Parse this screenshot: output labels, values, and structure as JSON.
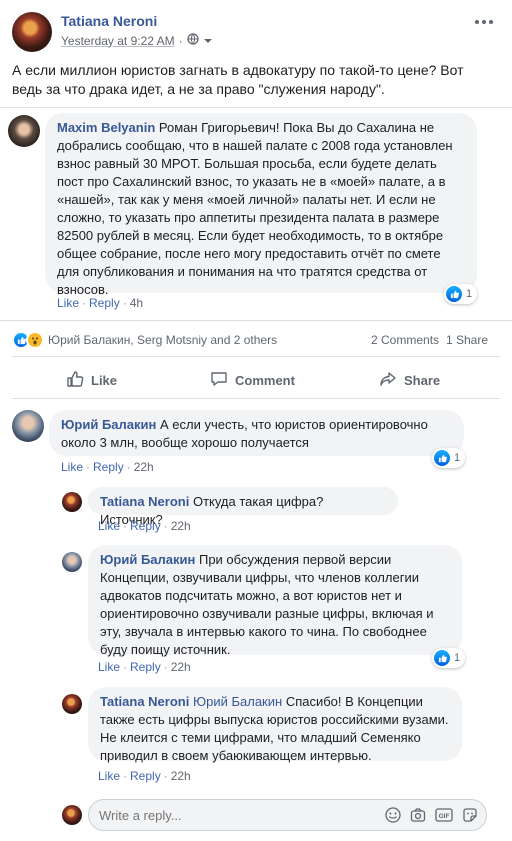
{
  "post": {
    "author": "Tatiana Neroni",
    "timestamp": "Yesterday at 9:22 AM",
    "audience_icon": "globe-icon",
    "text": "А если миллион юристов загнать в адвокатуру по такой-то цене? Вот ведь за что драка идет, а не за право \"служения народу\"."
  },
  "top_comment": {
    "author": "Maxim Belyanin",
    "text": "Роман Григорьевич! Пока Вы до Сахалина не добрались сообщаю, что в нашей палате с 2008 года установлен взнос равный 30 МРОТ. Большая просьба, если будете делать пост про Сахалинский взнос, то указать не в «моей» палате, а в «нашей», так как у меня «моей личной» палаты нет. И если не сложно, то указать про аппетиты президента палата в размере 82500 рублей в месяц. Если будет необходимость, то в октябре общее собрание, после него могу предоставить отчёт по смете для опубликования и понимания на что тратятся средства от взносов.",
    "like_label": "Like",
    "reply_label": "Reply",
    "time": "4h",
    "reactions": "1"
  },
  "summary": {
    "reactors": "Юрий Балакин, Serg Motsniy and 2 others",
    "comments": "2 Comments",
    "shares": "1 Share"
  },
  "action_bar": {
    "like": "Like",
    "comment": "Comment",
    "share": "Share"
  },
  "comments": [
    {
      "author": "Юрий Балакин",
      "text": "А если учесть, что юристов ориентировочно около 3 млн, вообще хорошо получается",
      "like_label": "Like",
      "reply_label": "Reply",
      "time": "22h",
      "reactions": "1"
    },
    {
      "author": "Tatiana Neroni",
      "text": "Откуда такая цифра? Источник?",
      "like_label": "Like",
      "reply_label": "Reply",
      "time": "22h"
    },
    {
      "author": "Юрий Балакин",
      "text": "При обсуждения первой версии Концепции, озвучивали цифры, что членов коллегии адвокатов подсчитать можно, а вот юристов нет и ориентировочно озвучивали разные цифры, включая и эту, звучала в интервью какого то чина. По свободнее буду поищу источник.",
      "like_label": "Like",
      "reply_label": "Reply",
      "time": "22h",
      "reactions": "1"
    },
    {
      "author": "Tatiana Neroni",
      "mention": "Юрий Балакин",
      "text": "Спасибо! В Концепции также есть цифры выпуска юристов российскими вузами. Не клеится с теми цифрами, что младший Семеняко приводил в своем убаюкивающем интервью.",
      "like_label": "Like",
      "reply_label": "Reply",
      "time": "22h"
    }
  ],
  "reply_box": {
    "placeholder": "Write a reply..."
  }
}
